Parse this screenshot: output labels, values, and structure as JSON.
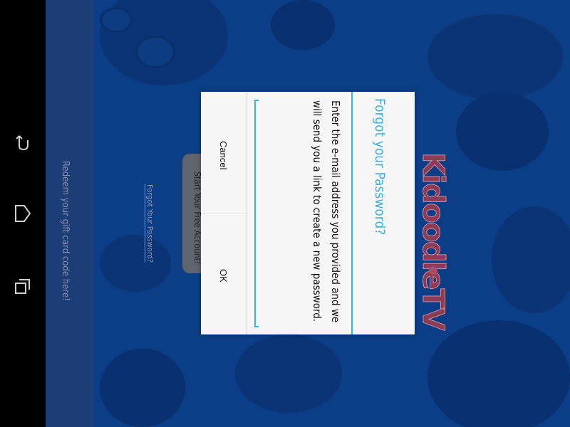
{
  "navbar": {
    "back_icon": "back-icon",
    "home_icon": "home-icon",
    "recents_icon": "recents-icon"
  },
  "sidebar": {
    "redeem_label": "Redeem your gift card code here!"
  },
  "main": {
    "start_button_label": "Start Your Free Account!",
    "forgot_link_label": "Forgot Your Password?",
    "logo_text": "KidoodleTV"
  },
  "dialog": {
    "title": "Forgot your Password?",
    "message": "Enter the e-mail address you provided and we will send you a link to create a new password.",
    "email_value": "",
    "email_placeholder": "",
    "cancel_label": "Cancel",
    "ok_label": "OK"
  },
  "colors": {
    "accent": "#33b5e5",
    "background": "#0c3e87",
    "sidebar": "#1c3d78",
    "logo": "#8b3d57"
  }
}
